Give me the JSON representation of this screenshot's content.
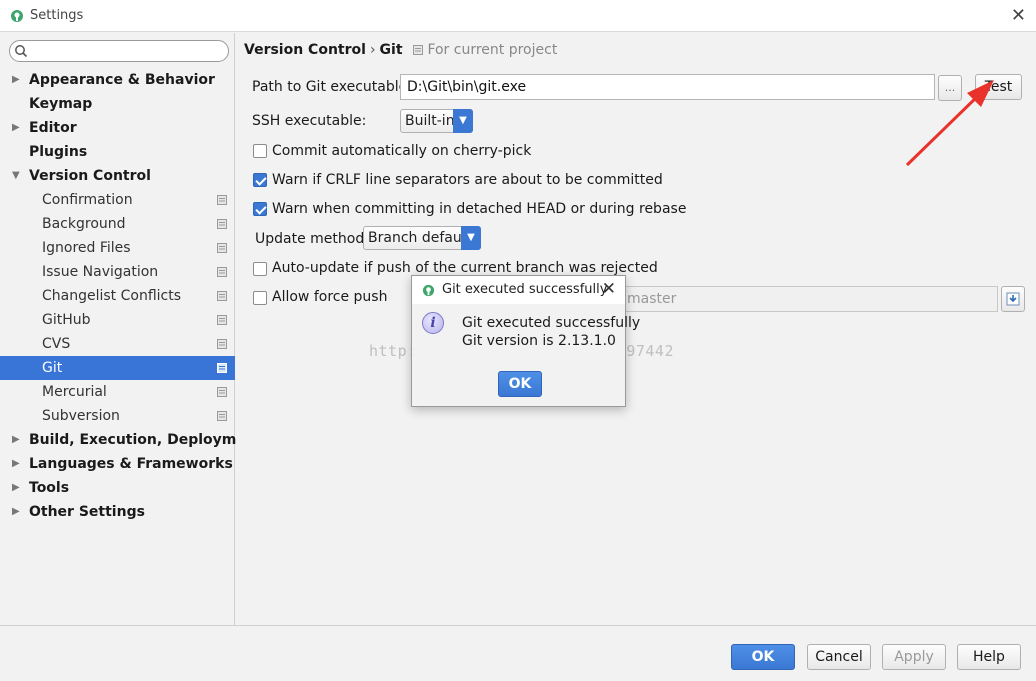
{
  "window": {
    "title": "Settings",
    "close_glyph": "✕"
  },
  "search": {
    "placeholder": "",
    "icon": "search-icon"
  },
  "sidebar": {
    "items": [
      {
        "label": "Appearance & Behavior",
        "expandable": true,
        "expanded": false
      },
      {
        "label": "Keymap",
        "expandable": false
      },
      {
        "label": "Editor",
        "expandable": true,
        "expanded": false
      },
      {
        "label": "Plugins",
        "expandable": false
      },
      {
        "label": "Version Control",
        "expandable": true,
        "expanded": true
      },
      {
        "label": "Confirmation",
        "child": true
      },
      {
        "label": "Background",
        "child": true
      },
      {
        "label": "Ignored Files",
        "child": true
      },
      {
        "label": "Issue Navigation",
        "child": true
      },
      {
        "label": "Changelist Conflicts",
        "child": true
      },
      {
        "label": "GitHub",
        "child": true
      },
      {
        "label": "CVS",
        "child": true
      },
      {
        "label": "Git",
        "child": true,
        "selected": true
      },
      {
        "label": "Mercurial",
        "child": true
      },
      {
        "label": "Subversion",
        "child": true
      },
      {
        "label": "Build, Execution, Deployment",
        "expandable": true,
        "expanded": false
      },
      {
        "label": "Languages & Frameworks",
        "expandable": true,
        "expanded": false
      },
      {
        "label": "Tools",
        "expandable": true,
        "expanded": false
      },
      {
        "label": "Other Settings",
        "expandable": true,
        "expanded": false
      }
    ]
  },
  "breadcrumb": {
    "parent": "Version Control",
    "separator": "›",
    "current": "Git",
    "hint": "For current project"
  },
  "git": {
    "path_label": "Path to Git executable:",
    "path_value": "D:\\Git\\bin\\git.exe",
    "browse_label": "...",
    "test_label": "Test",
    "ssh_label": "SSH executable:",
    "ssh_value": "Built-in",
    "commit_cherry_pick_label": "Commit automatically on cherry-pick",
    "commit_cherry_pick_checked": false,
    "warn_crlf_label": "Warn if CRLF line separators are about to be committed",
    "warn_crlf_checked": true,
    "warn_detached_label": "Warn when committing in detached HEAD or during rebase",
    "warn_detached_checked": true,
    "update_method_label": "Update method:",
    "update_method_value": "Branch default",
    "auto_update_label": "Auto-update if push of the current branch was rejected",
    "auto_update_checked": false,
    "force_push_label": "Allow force push",
    "force_push_checked": false,
    "protected_branches_value": "master"
  },
  "dialog": {
    "title": "Git executed successfully",
    "message_line1": "Git executed successfully",
    "message_line2": "Git version is 2.13.1.0",
    "ok_label": "OK",
    "close_glyph": "✕"
  },
  "watermark": "http://blog.csdn.net/qq_34897442",
  "footer": {
    "ok_label": "OK",
    "cancel_label": "Cancel",
    "apply_label": "Apply",
    "help_label": "Help"
  },
  "colors": {
    "accent": "#3875d7",
    "annotation_arrow": "#e8322b"
  }
}
